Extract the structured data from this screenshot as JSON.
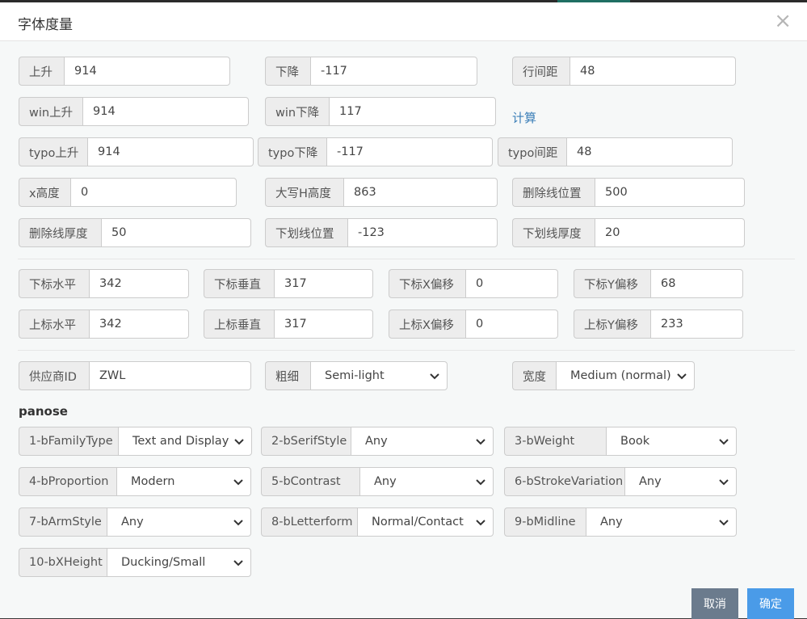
{
  "title": "字体度量",
  "close_label": "×",
  "metrics": {
    "ascent": {
      "label": "上升",
      "value": "914"
    },
    "descent": {
      "label": "下降",
      "value": "-117"
    },
    "line_gap": {
      "label": "行间距",
      "value": "48"
    },
    "win_ascent": {
      "label": "win上升",
      "value": "914"
    },
    "win_descent": {
      "label": "win下降",
      "value": "117"
    },
    "calc_link": "计算",
    "typo_ascent": {
      "label": "typo上升",
      "value": "914"
    },
    "typo_descent": {
      "label": "typo下降",
      "value": "-117"
    },
    "typo_line_gap": {
      "label": "typo间距",
      "value": "48"
    },
    "x_height": {
      "label": "x高度",
      "value": "0"
    },
    "cap_height": {
      "label": "大写H高度",
      "value": "863"
    },
    "strikeout_position": {
      "label": "删除线位置",
      "value": "500"
    },
    "strikeout_size": {
      "label": "删除线厚度",
      "value": "50"
    },
    "underline_position": {
      "label": "下划线位置",
      "value": "-123"
    },
    "underline_thickness": {
      "label": "下划线厚度",
      "value": "20"
    }
  },
  "scripts": {
    "subscript_x_size": {
      "label": "下标水平",
      "value": "342"
    },
    "subscript_y_size": {
      "label": "下标垂直",
      "value": "317"
    },
    "subscript_x_offset": {
      "label": "下标X偏移",
      "value": "0"
    },
    "subscript_y_offset": {
      "label": "下标Y偏移",
      "value": "68"
    },
    "superscript_x_size": {
      "label": "上标水平",
      "value": "342"
    },
    "superscript_y_size": {
      "label": "上标垂直",
      "value": "317"
    },
    "superscript_x_offset": {
      "label": "上标X偏移",
      "value": "0"
    },
    "superscript_y_offset": {
      "label": "上标Y偏移",
      "value": "233"
    }
  },
  "vendor": {
    "label": "供应商ID",
    "value": "ZWL"
  },
  "weight": {
    "label": "粗细",
    "value": "Semi-light"
  },
  "width": {
    "label": "宽度",
    "value": "Medium (normal)"
  },
  "panose_title": "panose",
  "panose": [
    {
      "label": "1-bFamilyType",
      "value": "Text and Display"
    },
    {
      "label": "2-bSerifStyle",
      "value": "Any"
    },
    {
      "label": "3-bWeight",
      "value": "Book"
    },
    {
      "label": "4-bProportion",
      "value": "Modern"
    },
    {
      "label": "5-bContrast",
      "value": "Any"
    },
    {
      "label": "6-bStrokeVariation",
      "value": "Any"
    },
    {
      "label": "7-bArmStyle",
      "value": "Any"
    },
    {
      "label": "8-bLetterform",
      "value": "Normal/Contact"
    },
    {
      "label": "9-bMidline",
      "value": "Any"
    },
    {
      "label": "10-bXHeight",
      "value": "Ducking/Small"
    }
  ],
  "buttons": {
    "cancel": "取消",
    "ok": "确定"
  }
}
